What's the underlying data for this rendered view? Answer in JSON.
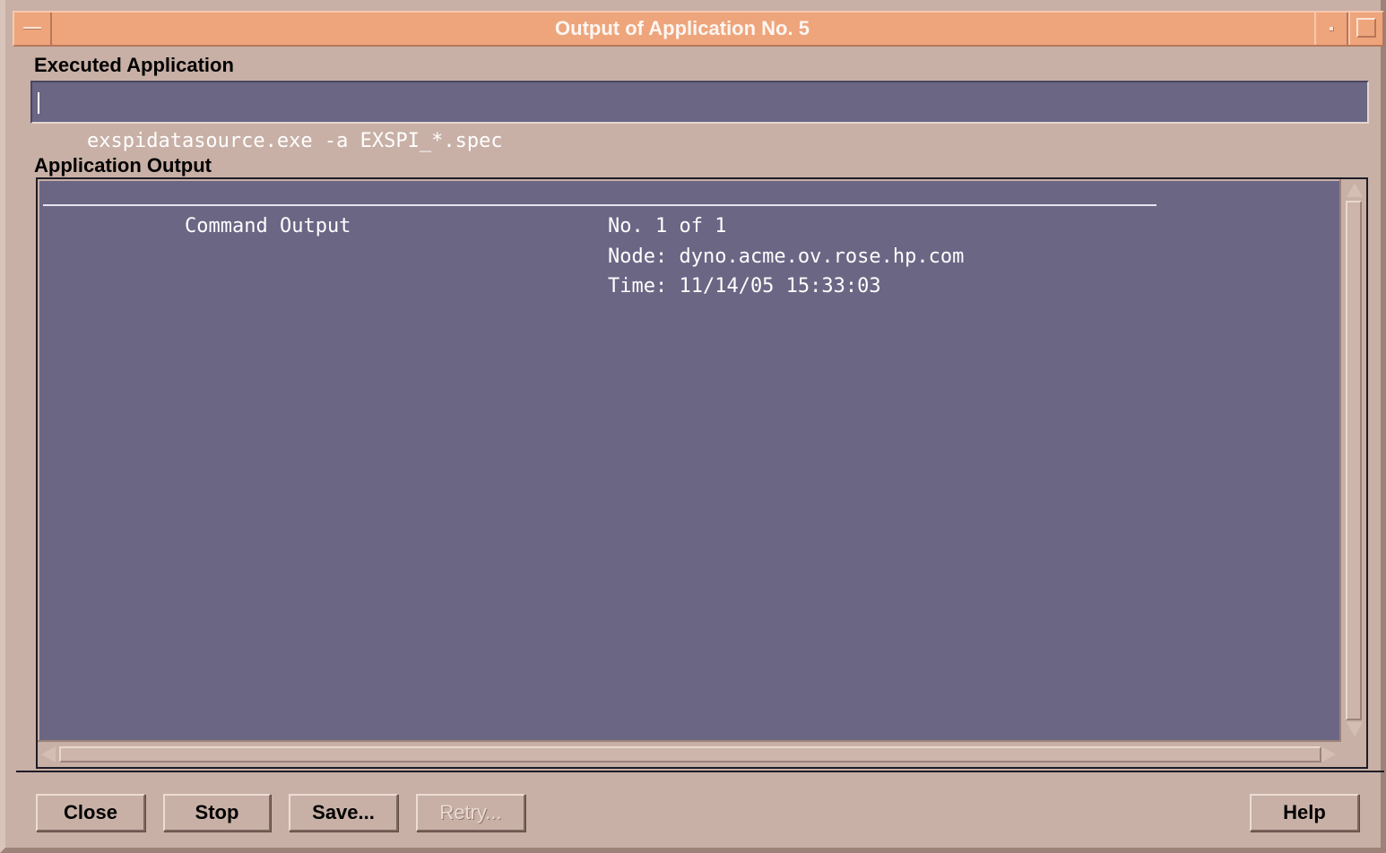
{
  "window": {
    "title": "Output of Application No. 5"
  },
  "executed_application": {
    "label": "Executed Application",
    "command": "exspidatasource.exe -a EXSPI_*.spec"
  },
  "application_output": {
    "label": "Application Output",
    "header_left": "Command Output",
    "lines": [
      "No. 1 of 1",
      "Node: dyno.acme.ov.rose.hp.com",
      "Time: 11/14/05 15:33:03"
    ]
  },
  "buttons": {
    "close": "Close",
    "stop": "Stop",
    "save": "Save...",
    "retry": "Retry...",
    "help": "Help"
  },
  "colors": {
    "titlebar": "#eea57c",
    "window_bg": "#c8b0a6",
    "text_area_bg": "#6b6684",
    "text_area_fg": "#ffffff"
  }
}
